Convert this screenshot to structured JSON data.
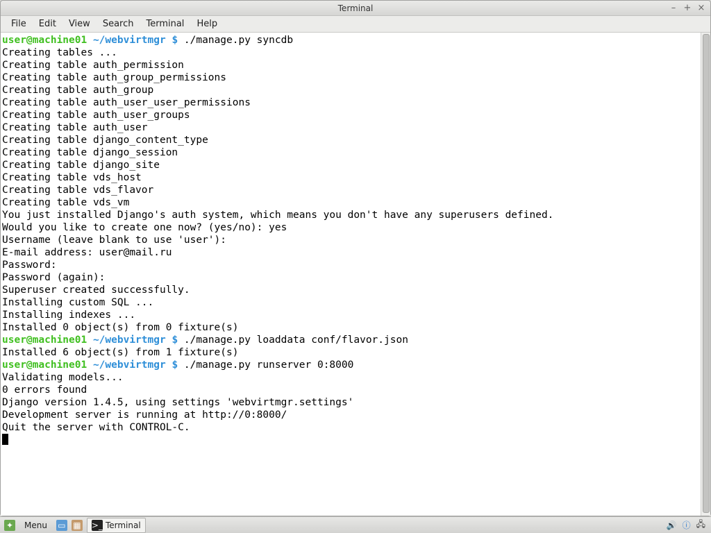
{
  "window": {
    "title": "Terminal"
  },
  "menubar": [
    "File",
    "Edit",
    "View",
    "Search",
    "Terminal",
    "Help"
  ],
  "prompt": {
    "user_host": "user@machine01",
    "path": "~/webvirtmgr",
    "sep": " $ "
  },
  "session": [
    {
      "type": "prompt",
      "cmd": "./manage.py syncdb"
    },
    {
      "type": "out",
      "text": "Creating tables ..."
    },
    {
      "type": "out",
      "text": "Creating table auth_permission"
    },
    {
      "type": "out",
      "text": "Creating table auth_group_permissions"
    },
    {
      "type": "out",
      "text": "Creating table auth_group"
    },
    {
      "type": "out",
      "text": "Creating table auth_user_user_permissions"
    },
    {
      "type": "out",
      "text": "Creating table auth_user_groups"
    },
    {
      "type": "out",
      "text": "Creating table auth_user"
    },
    {
      "type": "out",
      "text": "Creating table django_content_type"
    },
    {
      "type": "out",
      "text": "Creating table django_session"
    },
    {
      "type": "out",
      "text": "Creating table django_site"
    },
    {
      "type": "out",
      "text": "Creating table vds_host"
    },
    {
      "type": "out",
      "text": "Creating table vds_flavor"
    },
    {
      "type": "out",
      "text": "Creating table vds_vm"
    },
    {
      "type": "out",
      "text": ""
    },
    {
      "type": "out",
      "text": "You just installed Django's auth system, which means you don't have any superusers defined."
    },
    {
      "type": "out",
      "text": "Would you like to create one now? (yes/no): yes"
    },
    {
      "type": "out",
      "text": "Username (leave blank to use 'user'):"
    },
    {
      "type": "out",
      "text": "E-mail address: user@mail.ru"
    },
    {
      "type": "out",
      "text": "Password:"
    },
    {
      "type": "out",
      "text": "Password (again):"
    },
    {
      "type": "out",
      "text": "Superuser created successfully."
    },
    {
      "type": "out",
      "text": "Installing custom SQL ..."
    },
    {
      "type": "out",
      "text": "Installing indexes ..."
    },
    {
      "type": "out",
      "text": "Installed 0 object(s) from 0 fixture(s)"
    },
    {
      "type": "prompt",
      "cmd": "./manage.py loaddata conf/flavor.json"
    },
    {
      "type": "out",
      "text": "Installed 6 object(s) from 1 fixture(s)"
    },
    {
      "type": "prompt",
      "cmd": "./manage.py runserver 0:8000"
    },
    {
      "type": "out",
      "text": "Validating models..."
    },
    {
      "type": "out",
      "text": ""
    },
    {
      "type": "out",
      "text": "0 errors found"
    },
    {
      "type": "out",
      "text": "Django version 1.4.5, using settings 'webvirtmgr.settings'"
    },
    {
      "type": "out",
      "text": "Development server is running at http://0:8000/"
    },
    {
      "type": "out",
      "text": "Quit the server with CONTROL-C."
    }
  ],
  "taskbar": {
    "menu_label": "Menu",
    "active_app": "Terminal"
  }
}
